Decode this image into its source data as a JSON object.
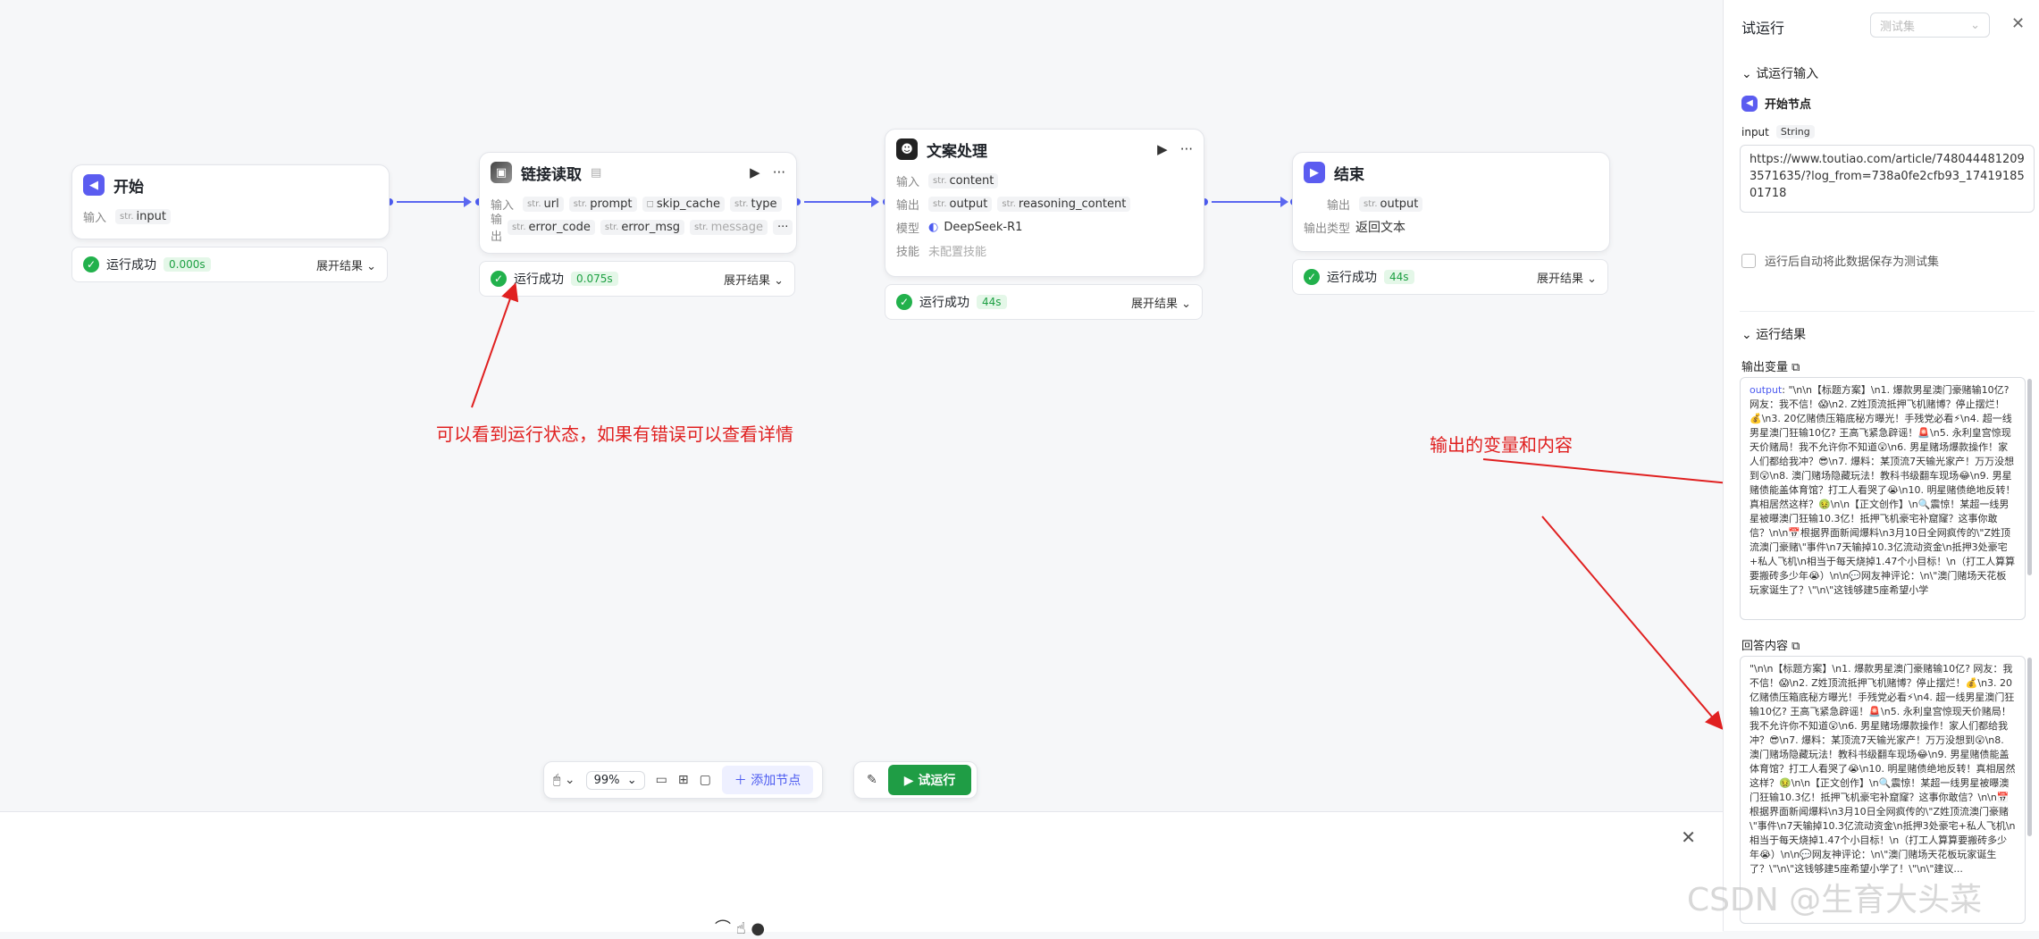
{
  "nodes": {
    "start": {
      "title": "开始",
      "input_label": "输入",
      "input_type": "str.",
      "input_name": "input"
    },
    "link": {
      "title": "链接读取",
      "input_label": "输入",
      "output_label": "输出",
      "inputs": [
        {
          "type": "str.",
          "name": "url"
        },
        {
          "type": "str.",
          "name": "prompt"
        },
        {
          "type": "◻",
          "name": "skip_cache"
        },
        {
          "type": "str.",
          "name": "type"
        }
      ],
      "outputs": [
        {
          "type": "str.",
          "name": "error_code"
        },
        {
          "type": "str.",
          "name": "error_msg"
        },
        {
          "type": "str.",
          "name": "message"
        }
      ],
      "more": "···"
    },
    "text": {
      "title": "文案处理",
      "input_label": "输入",
      "output_label": "输出",
      "model_label": "模型",
      "skill_label": "技能",
      "inputs": [
        {
          "type": "str.",
          "name": "content"
        }
      ],
      "outputs": [
        {
          "type": "str.",
          "name": "output"
        },
        {
          "type": "str.",
          "name": "reasoning_content"
        }
      ],
      "model": "DeepSeek-R1",
      "skill": "未配置技能"
    },
    "end": {
      "title": "结束",
      "output_label": "输出",
      "output_type": "str.",
      "output_name": "output",
      "output_kind_label": "输出类型",
      "output_kind": "返回文本"
    }
  },
  "status": {
    "label": "运行成功",
    "expand": "展开结果",
    "times": {
      "start": "0.000s",
      "link": "0.075s",
      "text": "44s",
      "end": "44s"
    }
  },
  "annotations": {
    "left": "可以看到运行状态，如果有错误可以查看详情",
    "right": "输出的变量和内容"
  },
  "toolbar": {
    "zoom": "99%",
    "add_node": "添加节点",
    "run": "试运行"
  },
  "panel": {
    "title": "试运行",
    "select_placeholder": "测试集",
    "section_input": "试运行输入",
    "start_node": "开始节点",
    "input_name": "input",
    "input_type": "String",
    "input_value": "https://www.toutiao.com/article/7480444812093571635/?log_from=738a0fe2cfb93_1741918501718",
    "save_checkbox": "运行后自动将此数据保存为测试集",
    "section_result": "运行结果",
    "output_var_label": "输出变量",
    "output_key": "output",
    "output_text": "\"\\n\\n【标题方案】\\n1. 爆款男星澳门豪赌输10亿? 网友：我不信！😱\\n2. Z姓顶流抵押飞机赌博？停止摆烂！💰\\n3. 20亿赌债压箱底秘方曝光！手残党必看⚡\\n4. 超一线男星澳门狂输10亿? 王高飞紧急辟谣！🚨\\n5. 永利皇宫惊现天价赌局！我不允许你不知道😲\\n6. 男星赌场爆款操作！家人们都给我冲？😎\\n7. 爆料：某顶流7天输光家产！万万没想到😲\\n8. 澳门赌场隐藏玩法！教科书级翻车现场😂\\n9. 男星赌债能盖体育馆？打工人看哭了😭\\n10. 明星赌债绝地反转！真相居然这样？🤢\\n\\n【正文创作】\\n🔍震惊！某超一线男星被曝澳门狂输10.3亿！抵押飞机豪宅补窟窿？这事你敢信？\\n\\n📅根据界面新闻爆料\\n3月10日全网疯传的\\\"Z姓顶流澳门豪赌\\\"事件\\n7天输掉10.3亿流动资金\\n抵押3处豪宅+私人飞机\\n相当于每天烧掉1.47个小目标！\\n（打工人算算要搬砖多少年😭）\\n\\n💬网友神评论：\\n\\\"澳门赌场天花板玩家诞生了？\\\"\\n\\\"这钱够建5座希望小学",
    "answer_label": "回答内容",
    "answer_text": "\"\\n\\n【标题方案】\\n1. 爆款男星澳门豪赌输10亿? 网友：我不信！😱\\n2. Z姓顶流抵押飞机赌博？停止摆烂！💰\\n3. 20亿赌债压箱底秘方曝光！手残党必看⚡\\n4. 超一线男星澳门狂输10亿? 王高飞紧急辟谣！🚨\\n5. 永利皇宫惊现天价赌局！我不允许你不知道😲\\n6. 男星赌场爆款操作！家人们都给我冲？😎\\n7. 爆料：某顶流7天输光家产！万万没想到😲\\n8. 澳门赌场隐藏玩法！教科书级翻车现场😂\\n9. 男星赌债能盖体育馆？打工人看哭了😭\\n10. 明星赌债绝地反转！真相居然这样？🤢\\n\\n【正文创作】\\n🔍震惊！某超一线男星被曝澳门狂输10.3亿！抵押飞机豪宅补窟窿？这事你敢信？\\n\\n📅根据界面新闻爆料\\n3月10日全网疯传的\\\"Z姓顶流澳门豪赌\\\"事件\\n7天输掉10.3亿流动资金\\n抵押3处豪宅+私人飞机\\n相当于每天烧掉1.47个小目标！\\n（打工人算算要搬砖多少年😭）\\n\\n💬网友神评论：\\n\\\"澳门赌场天花板玩家诞生了？\\\"\\n\\\"这钱够建5座希望小学了！\\\"\\n\\\"建议..."
  },
  "watermark": "CSDN @生育大头菜",
  "colors": {
    "accent": "#4c5bf0",
    "success": "#22b14c",
    "run_button": "#1f9d45",
    "annotation": "#e02020"
  }
}
